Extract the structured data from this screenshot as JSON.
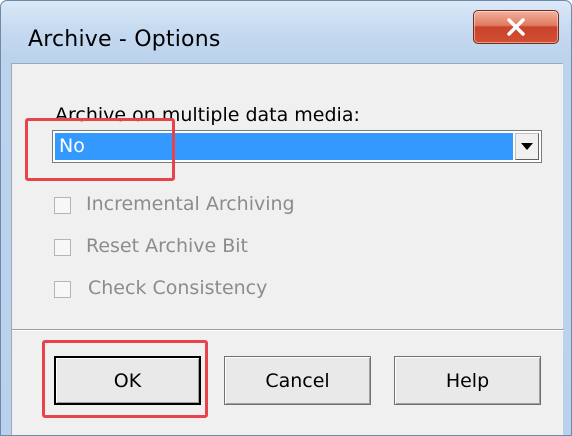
{
  "window": {
    "title": "Archive - Options"
  },
  "media": {
    "label": "Archive on multiple data media:",
    "selected": "No"
  },
  "options": [
    {
      "label": "Incremental Archiving",
      "checked": false,
      "enabled": false
    },
    {
      "label": "Reset Archive Bit",
      "checked": false,
      "enabled": false
    },
    {
      "label": "Check Consistency",
      "checked": false,
      "enabled": false
    }
  ],
  "buttons": {
    "ok": "OK",
    "cancel": "Cancel",
    "help": "Help"
  },
  "colors": {
    "selection": "#3399ff",
    "highlight_annotation": "#e8434b",
    "close_button": "#c7432a"
  }
}
